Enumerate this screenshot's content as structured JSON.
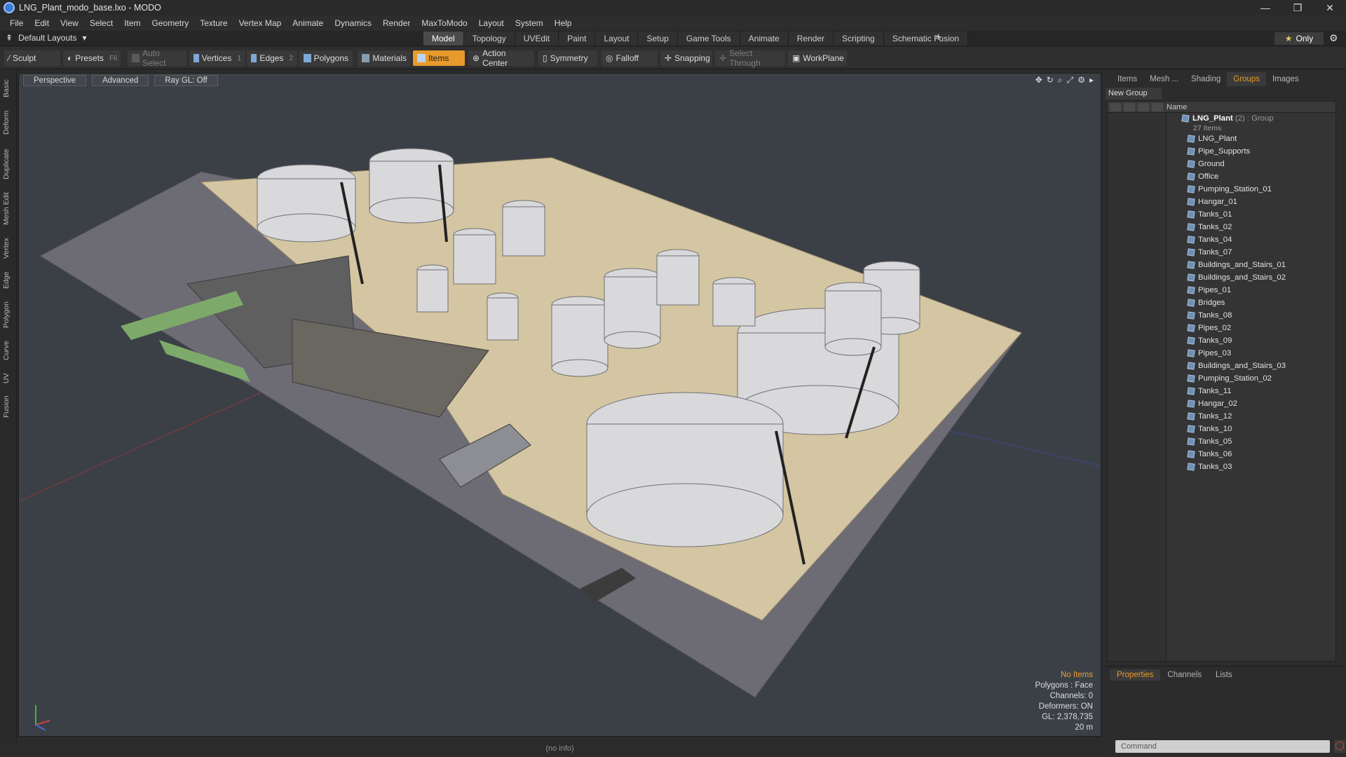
{
  "window": {
    "title": "LNG_Plant_modo_base.lxo - MODO",
    "controls": [
      "—",
      "❐",
      "✕"
    ]
  },
  "menu": [
    "File",
    "Edit",
    "View",
    "Select",
    "Item",
    "Geometry",
    "Texture",
    "Vertex Map",
    "Animate",
    "Dynamics",
    "Render",
    "MaxToModo",
    "Layout",
    "System",
    "Help"
  ],
  "layout_bar": {
    "layout_dropdown": "Default Layouts",
    "tabs": [
      "Model",
      "Topology",
      "UVEdit",
      "Paint",
      "Layout",
      "Setup",
      "Game Tools",
      "Animate",
      "Render",
      "Scripting",
      "Schematic Fusion"
    ],
    "active_tab": "Model",
    "plus": "+",
    "only_label": "Only"
  },
  "toolbar": {
    "sculpt": "Sculpt",
    "presets": "Presets",
    "presets_key": "F6",
    "auto_select": "Auto Select",
    "vertices": "Vertices",
    "vertices_num": "1",
    "edges": "Edges",
    "edges_num": "2",
    "polygons": "Polygons",
    "materials": "Materials",
    "items": "Items",
    "action_center": "Action Center",
    "symmetry": "Symmetry",
    "falloff": "Falloff",
    "snapping": "Snapping",
    "select_through": "Select Through",
    "workplane": "WorkPlane"
  },
  "left_tabs": [
    "Basic",
    "Deform",
    "Duplicate",
    "Mesh Edit",
    "Vertex",
    "Edge",
    "Polygon",
    "Curve",
    "UV",
    "Fusion"
  ],
  "viewport": {
    "buttons": [
      "Perspective",
      "Advanced",
      "Ray GL: Off"
    ],
    "info": {
      "no_items": "No Items",
      "polygons": "Polygons : Face",
      "channels": "Channels: 0",
      "deformers": "Deformers: ON",
      "gl": "GL: 2,378,735",
      "scale": "20 m"
    }
  },
  "status": "(no info)",
  "right_panel": {
    "tabs": [
      "Items",
      "Mesh ...",
      "Shading",
      "Groups",
      "Images"
    ],
    "active_tab": "Groups",
    "new_group": "New Group",
    "column_name": "Name",
    "group": {
      "name": "LNG_Plant",
      "count": "(2)",
      "type": ": Group",
      "items_label": "27 Items"
    },
    "items": [
      "LNG_Plant",
      "Pipe_Supports",
      "Ground",
      "Office",
      "Pumping_Station_01",
      "Hangar_01",
      "Tanks_01",
      "Tanks_02",
      "Tanks_04",
      "Tanks_07",
      "Buildings_and_Stairs_01",
      "Buildings_and_Stairs_02",
      "Pipes_01",
      "Bridges",
      "Tanks_08",
      "Pipes_02",
      "Tanks_09",
      "Pipes_03",
      "Buildings_and_Stairs_03",
      "Pumping_Station_02",
      "Tanks_11",
      "Hangar_02",
      "Tanks_12",
      "Tanks_10",
      "Tanks_05",
      "Tanks_06",
      "Tanks_03"
    ],
    "bottom_tabs": [
      "Properties",
      "Channels",
      "Lists"
    ],
    "bottom_active": "Properties",
    "command_placeholder": "Command"
  }
}
